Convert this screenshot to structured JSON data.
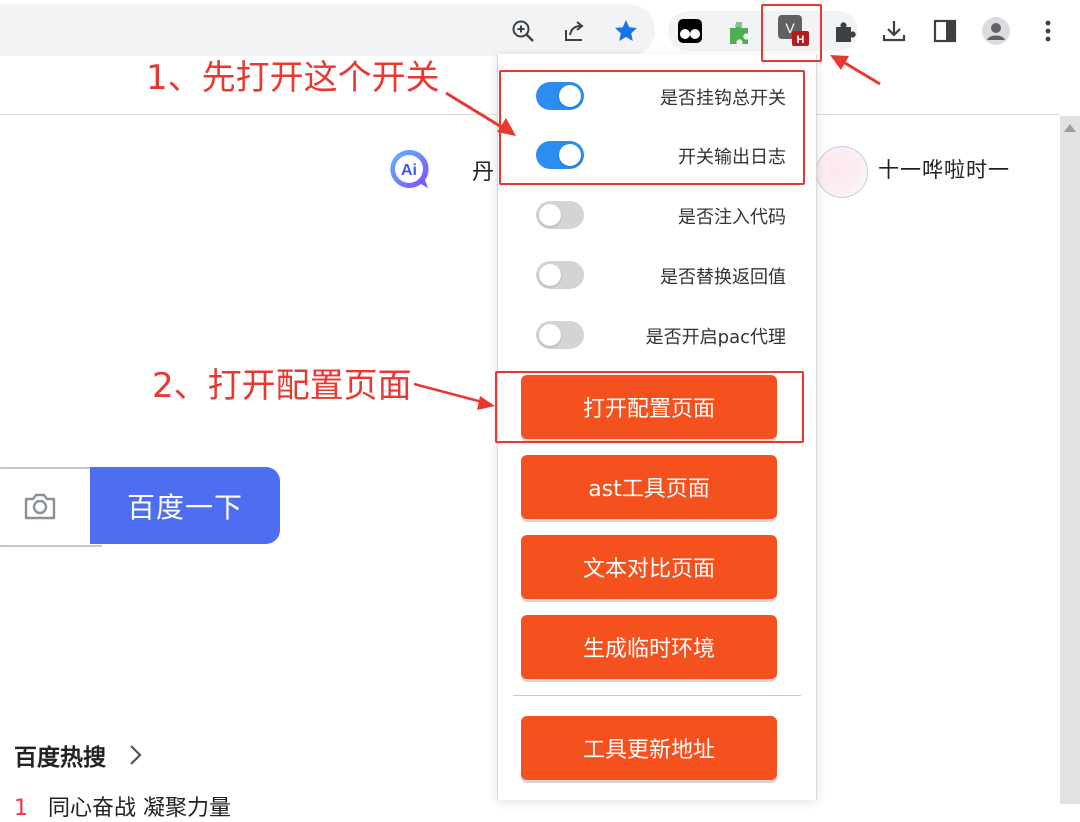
{
  "toolbar": {
    "zoom_icon": "zoom-in-icon",
    "share_icon": "share-icon",
    "bookmark_icon": "bookmark-star-icon",
    "extensions": [
      "tampermonkey-icon",
      "puzzle-green-extension-icon",
      "v-hook-extension-icon"
    ],
    "v_ext_letter": "V",
    "v_ext_badge": "H",
    "tail_icons": [
      "extensions-puzzle-icon",
      "download-icon",
      "side-panel-icon",
      "profile-icon",
      "kebab-menu-icon"
    ]
  },
  "page": {
    "ai_badge": "Ai",
    "user_fragment": "丹",
    "username": "十一哗啦时一",
    "search_button": "百度一下",
    "hot_search_title": "百度热搜",
    "hot_search_first": {
      "rank": "1",
      "text": "同心奋战 凝聚力量"
    }
  },
  "popup": {
    "toggles": [
      {
        "label": "是否挂钩总开关",
        "on": true
      },
      {
        "label": "开关输出日志",
        "on": true
      },
      {
        "label": "是否注入代码",
        "on": false
      },
      {
        "label": "是否替换返回值",
        "on": false
      },
      {
        "label": "是否开启pac代理",
        "on": false
      }
    ],
    "buttons": [
      "打开配置页面",
      "ast工具页面",
      "文本对比页面",
      "生成临时环境",
      "工具更新地址"
    ]
  },
  "annotations": {
    "step1": "1、先打开这个开关",
    "step2": "2、打开配置页面"
  },
  "colors": {
    "accent_orange": "#f5511e",
    "toggle_on": "#2d8cf0",
    "annotation_red": "#e8382f",
    "baidu_blue": "#4e6ef2"
  }
}
